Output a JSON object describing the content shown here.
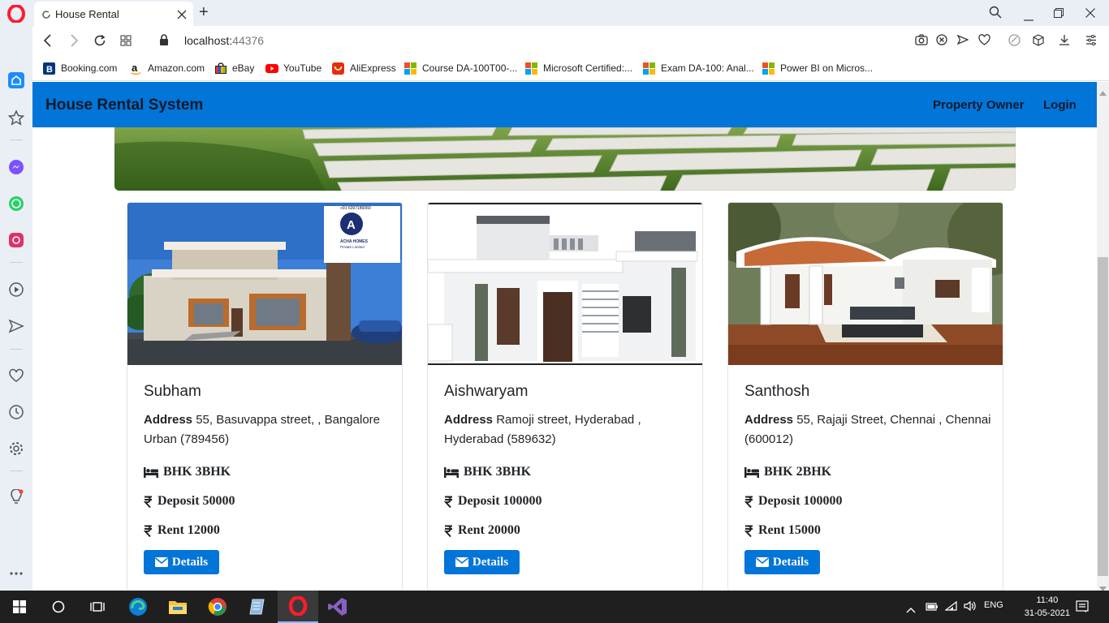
{
  "browser": {
    "tab_title": "House Rental",
    "new_tab_symbol": "+",
    "url_host": "localhost:",
    "url_port": "44376",
    "bookmarks": [
      {
        "label": "Booking.com",
        "icon": "booking-icon"
      },
      {
        "label": "Amazon.com",
        "icon": "amazon-icon"
      },
      {
        "label": "eBay",
        "icon": "ebay-icon"
      },
      {
        "label": "YouTube",
        "icon": "youtube-icon"
      },
      {
        "label": "AliExpress",
        "icon": "aliexpress-icon"
      },
      {
        "label": "Course DA-100T00-...",
        "icon": "microsoft-icon"
      },
      {
        "label": "Microsoft Certified:...",
        "icon": "microsoft-icon"
      },
      {
        "label": "Exam DA-100: Anal...",
        "icon": "microsoft-icon"
      },
      {
        "label": "Power BI on Micros...",
        "icon": "microsoft-icon"
      }
    ]
  },
  "navbar": {
    "brand": "House Rental System",
    "links": [
      "Property Owner",
      "Login"
    ]
  },
  "properties": [
    {
      "name": "Subham",
      "address_label": "Address",
      "address": "55, Basuvappa street, , Bangalore Urban (789456)",
      "bhk": "BHK 3BHK",
      "deposit": "Deposit 50000",
      "rent": "Rent 12000",
      "button": "Details",
      "image_badge": [
        "ACHA HOMES",
        "Private Limited",
        "+91 6397186060"
      ]
    },
    {
      "name": "Aishwaryam",
      "address_label": "Address",
      "address": "Ramoji street, Hyderabad , Hyderabad (589632)",
      "bhk": "BHK 3BHK",
      "deposit": "Deposit 100000",
      "rent": "Rent 20000",
      "button": "Details"
    },
    {
      "name": "Santhosh",
      "address_label": "Address",
      "address": "55, Rajaji Street, Chennai , Chennai (600012)",
      "bhk": "BHK 2BHK",
      "deposit": "Deposit 100000",
      "rent": "Rent 15000",
      "button": "Details"
    }
  ],
  "taskbar": {
    "language": "ENG",
    "time": "11:40",
    "date": "31-05-2021"
  },
  "colors": {
    "primary": "#0275d8",
    "navbar_text": "#0b1a2c",
    "sidebar_bg": "#eaeff6",
    "taskbar_bg": "#1f1f1f"
  }
}
